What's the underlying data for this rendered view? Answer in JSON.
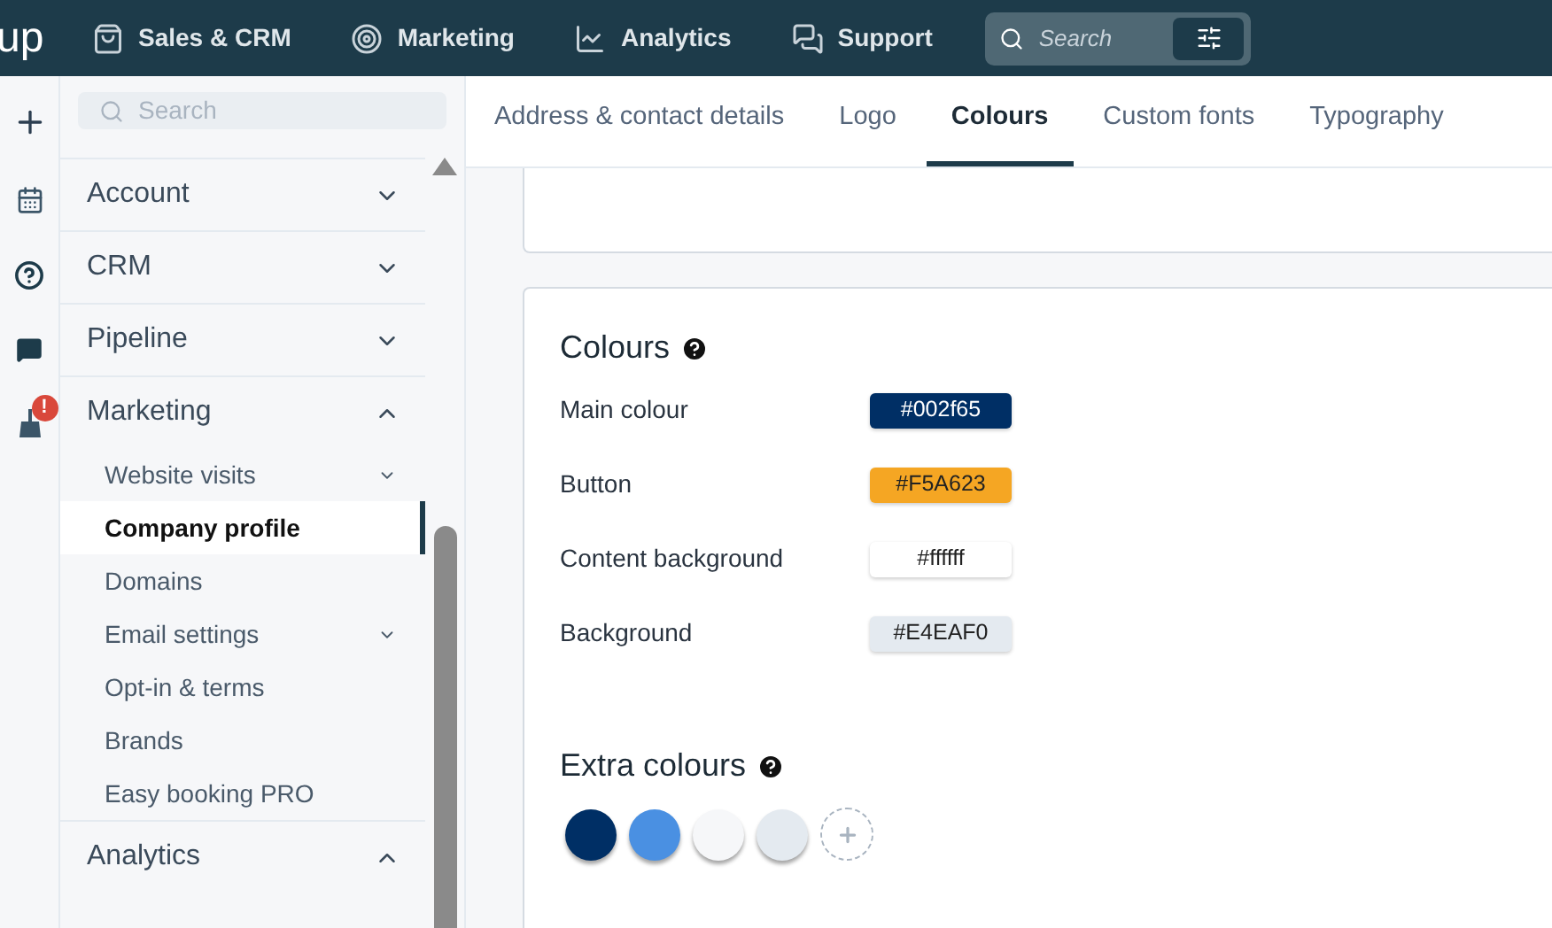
{
  "topbar": {
    "logo": "up",
    "nav": [
      {
        "kind": "sales",
        "label": "Sales & CRM"
      },
      {
        "kind": "marketing",
        "label": "Marketing"
      },
      {
        "kind": "analytics",
        "label": "Analytics"
      },
      {
        "kind": "support",
        "label": "Support"
      }
    ],
    "search": {
      "placeholder": "Search"
    }
  },
  "rail": [
    {
      "kind": "plus"
    },
    {
      "kind": "calendar"
    },
    {
      "kind": "help"
    },
    {
      "kind": "chat"
    },
    {
      "kind": "alert",
      "badge": "!"
    }
  ],
  "sidebar": {
    "search": {
      "placeholder": "Search"
    },
    "items": [
      {
        "label": "Account",
        "expanded": false
      },
      {
        "label": "CRM",
        "expanded": false
      },
      {
        "label": "Pipeline",
        "expanded": false
      },
      {
        "label": "Marketing",
        "expanded": true,
        "children": [
          {
            "label": "Website visits",
            "selected": false,
            "expandable": true
          },
          {
            "label": "Company profile",
            "selected": true,
            "expandable": false
          },
          {
            "label": "Domains",
            "selected": false,
            "expandable": false
          },
          {
            "label": "Email settings",
            "selected": false,
            "expandable": true
          },
          {
            "label": "Opt-in & terms",
            "selected": false,
            "expandable": false
          },
          {
            "label": "Brands",
            "selected": false,
            "expandable": false
          },
          {
            "label": "Easy booking PRO",
            "selected": false,
            "expandable": false
          }
        ]
      },
      {
        "label": "Analytics",
        "expanded": true
      }
    ]
  },
  "tabs": [
    {
      "label": "Address & contact details",
      "selected": false
    },
    {
      "label": "Logo",
      "selected": false
    },
    {
      "label": "Colours",
      "selected": true
    },
    {
      "label": "Custom fonts",
      "selected": false
    },
    {
      "label": "Typography",
      "selected": false
    }
  ],
  "colours": {
    "title": "Colours",
    "rows": [
      {
        "label": "Main colour",
        "value": "#002f65",
        "color": "#002f65"
      },
      {
        "label": "Button",
        "value": "#F5A623",
        "color": "#f5a623"
      },
      {
        "label": "Content background",
        "value": "#ffffff",
        "color": "#ffffff"
      },
      {
        "label": "Background",
        "value": "#E4EAF0",
        "color": "#e4eaf0"
      }
    ],
    "extra_title": "Extra colours",
    "extra": [
      {
        "color": "#002f65"
      },
      {
        "color": "#4a90e2"
      },
      {
        "color": "#f6f7f9"
      },
      {
        "color": "#e4eaf0"
      }
    ]
  }
}
